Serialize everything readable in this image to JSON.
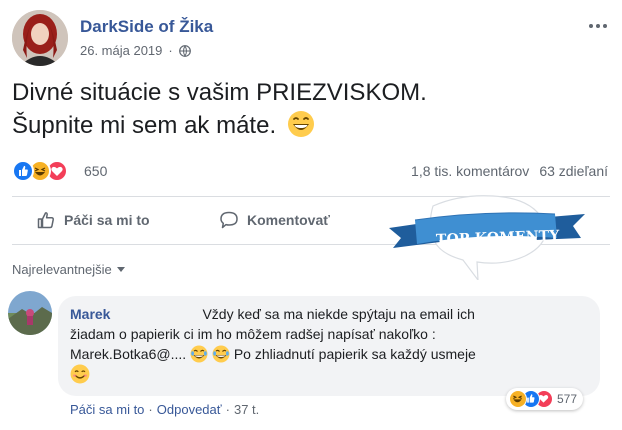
{
  "post": {
    "author": "DarkSide of Žika",
    "date": "26. mája 2019",
    "text_line1": "Divné situácie s vašim PRIEZVISKOM.",
    "text_line2": "Šupnite mi sem ak máte.",
    "text_emoji": "grinning-face-emoji",
    "privacy_icon": "globe-icon"
  },
  "reactions": {
    "icons": [
      "like-icon",
      "haha-icon",
      "love-icon"
    ],
    "count": "650",
    "comments": "1,8 tis. komentárov",
    "shares": "63 zdieľaní"
  },
  "actions": {
    "like_label": "Páči sa mi to",
    "comment_label": "Komentovať"
  },
  "badge": {
    "label": "TOP KOMENTY"
  },
  "sort": {
    "label": "Najrelevantnejšie"
  },
  "comment": {
    "author": "Marek",
    "line1": "Vždy keď sa ma niekde spýtaju na email ich",
    "line2": "žiadam o papierik ci im ho môžem radšej napísať nakoľko :",
    "line3a": "Marek.Botka6@....",
    "line3b": "Po zhliadnutí papierik sa každý usmeje",
    "reaction_count": "577",
    "like_label": "Páči sa mi to",
    "reply_label": "Odpovedať",
    "time": "37 t.",
    "separator": "·"
  },
  "colors": {
    "link": "#385898",
    "muted": "#606770",
    "like_blue": "#1877f2",
    "love_red": "#f33e58",
    "haha_yellow": "#f7b125",
    "badge_blue": "#3f8fd2"
  }
}
